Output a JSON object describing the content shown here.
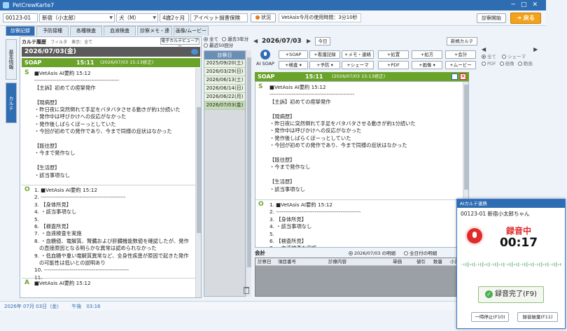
{
  "app": {
    "title": "PetCrewKarte7"
  },
  "patient": {
    "id": "00123-01",
    "name": "新宿（小太郎）",
    "species": "犬（M）",
    "age": "4歳2ヶ月",
    "insurance": "アイペット損害保険",
    "status_label": "状況",
    "usage": "VetAsis今月の使用時間：3分10秒",
    "start_label": "診察開始",
    "back_label": "戻る"
  },
  "tabs": [
    "診察記録",
    "予防接種",
    "各種検査",
    "血液検査",
    "診察メモ・連絡",
    "画像/ムービー"
  ],
  "side_tabs": [
    "基本情報",
    "カルテ"
  ],
  "history": {
    "title": "カルテ履歴",
    "filter": "フィルタ　表示：全て",
    "viewer_label": "電子カルテビューアー",
    "date": "2026/07/03(金)",
    "soap": "SOAP",
    "time": "15:11",
    "time_note": "(2026/07/03 15:13修正)",
    "s_text": "■VetAsis AI要約 15:12\n----------------------------------------------\n【主訴】初めての痙攣発作\n\n【現病歴】\n・昨日夜に突然倒れて手足をバタバタさせる動きが約1分続いた\n・発作中は呼びかけへの反応がなかった\n・発作後しばらくぼーっとしていた\n・今回が初めての発作であり、今まで同様の症状はなかった\n\n【既往歴】\n・今まで発作なし\n\n【生活歴】\n・該当事項なし",
    "o_text": "1. ■VetAsis AI要約 15:12\n2. ----------------------------------------------\n3. 【身体所見】\n4. ・該当事項なし\n5.\n6. 【検査所見】\n7. ・血液検査を実施\n8. ・血糖値、電解質、腎臓および肝臓機能数値を確認したが、発作\n   の直接原因となる明らかな異常は認められなかった\n9. ・低血糖や重い電解質異常など、全身性疾患が原因で起きた発作\n   の可能性は低いとの説明あり\n10. ----------------------------------------------\n11.",
    "a_text": "■VetAsis AI要約 15:12"
  },
  "dates": {
    "options": [
      "全て",
      "過去3年分",
      "最近50回分"
    ],
    "header": "診察日",
    "rows": [
      "2025/09/20(土)",
      "2026/03/29(日)",
      "2026/06/13(土)",
      "2026/06/14(日)",
      "2026/06/22(月)",
      "2026/07/03(金)"
    ]
  },
  "editor": {
    "date": "2026/07/03",
    "today_label": "今日",
    "new_label": "新規カルテ",
    "aisoap_label": "AI SOAP",
    "buttons_row1": [
      "+SOAP",
      "+看護記録",
      "+メモ・連絡",
      "+処置",
      "+処方",
      "+会計"
    ],
    "buttons_row2": [
      "+検査",
      "+予防",
      "+シェーマ",
      "+PDF",
      "+画像",
      "+ムービー"
    ],
    "soap": "SOAP",
    "time": "15:11",
    "time_note": "(2026/07/03 15:13修正)",
    "s_text": "■VetAsis AI要約 15:12\n----------------------------------------------\n【主訴】初めての痙攣発作\n\n【現病歴】\n・昨日夜に突然倒れて手足をバタバタさせる動きが約1分続いた\n・発作中は呼びかけへの反応がなかった\n・発作後しばらくぼーっとしていた\n・今回が初めての発作であり、今まで同様の症状はなかった\n\n【既往歴】\n・今まで発作なし\n\n【生活歴】\n・該当事項なし",
    "o_text": "1. ■VetAsis AI要約 15:12\n2. ----------------------------------------------\n3. 【身体所見】\n4. ・該当事項なし\n5.\n6. 【検査所見】\n7. ・血液検査を実施"
  },
  "side_options": [
    "全て",
    "シェーマ",
    "PDF",
    "画像",
    "動画"
  ],
  "accounting": {
    "title": "会計",
    "opt1": "2026/07/03 の明細",
    "opt2": "全日付の明細",
    "cols": [
      "診察日",
      "項目番号",
      "診療内容",
      "単価",
      "値引",
      "数量",
      "小計"
    ]
  },
  "statusbar": {
    "date": "2026年 07月 03日（金）",
    "time": "午後　03:16"
  },
  "recorder": {
    "title": "AIカルテ連携",
    "patient": "00123-01 新宿小太郎ちゃん",
    "label": "録音中",
    "time": "00:17",
    "done_label": "録音完了(F9)",
    "pause_label": "一時停止(F10)",
    "discard_label": "録音破棄(F11)"
  },
  "colors": {
    "accent": "#2f6db3",
    "soap_green": "#6aa32a",
    "record_red": "#e02b2b",
    "back_orange": "#f3a21a"
  }
}
